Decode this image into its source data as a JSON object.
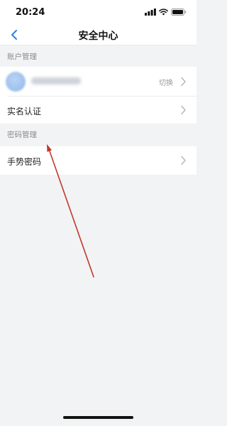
{
  "status_bar": {
    "time": "20:24",
    "icons": [
      "signal-icon",
      "wifi-icon",
      "battery-icon"
    ]
  },
  "nav": {
    "title": "安全中心",
    "back_icon": "chevron-left-icon"
  },
  "sections": {
    "account": {
      "header": "账户管理",
      "account_row": {
        "switch_label": "切换"
      },
      "realname_row": {
        "label": "实名认证"
      }
    },
    "password": {
      "header": "密码管理",
      "gesture_row": {
        "label": "手势密码"
      }
    }
  },
  "colors": {
    "accent": "#2f7fe0",
    "background": "#f2f3f5",
    "annotation_arrow": "#c0392b"
  }
}
